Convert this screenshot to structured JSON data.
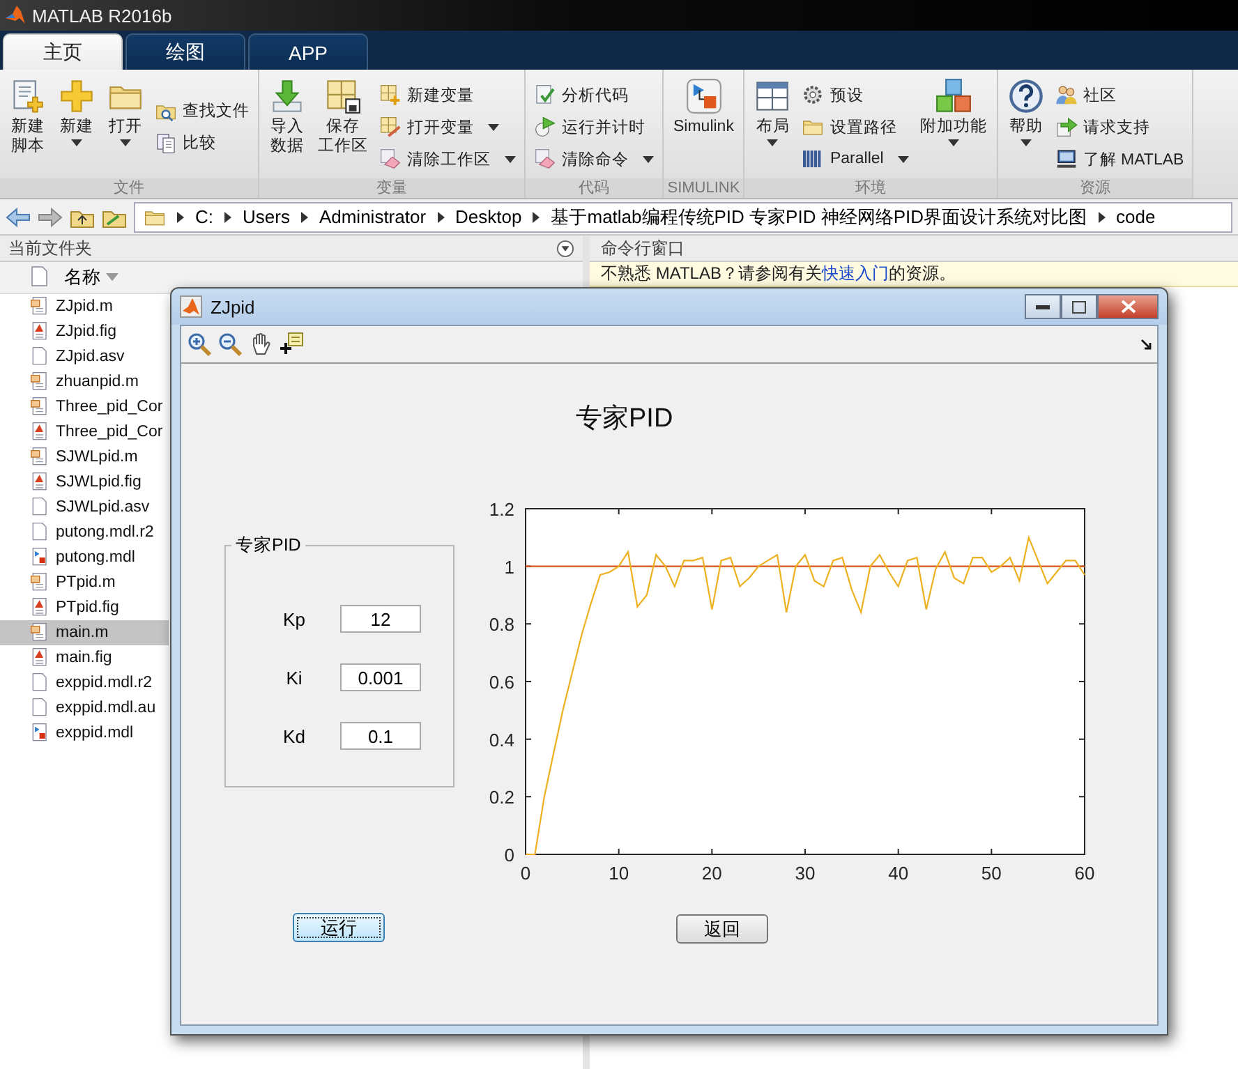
{
  "window": {
    "title": "MATLAB R2016b"
  },
  "tabs": [
    {
      "label": "主页",
      "selected": true
    },
    {
      "label": "绘图",
      "selected": false
    },
    {
      "label": "APP",
      "selected": false
    }
  ],
  "ribbon": {
    "groups": [
      {
        "label": "文件",
        "items": [
          {
            "kind": "large",
            "label": [
              "新建",
              "脚本"
            ],
            "dropdown": false
          },
          {
            "kind": "large",
            "label": "新建",
            "dropdown": true
          },
          {
            "kind": "large",
            "label": "打开",
            "dropdown": true
          },
          {
            "kind": "small",
            "label": "查找文件",
            "dropdown": false
          },
          {
            "kind": "small",
            "label": "比较",
            "dropdown": false
          }
        ]
      },
      {
        "label": "变量",
        "items": [
          {
            "kind": "large",
            "label": [
              "导入",
              "数据"
            ],
            "dropdown": false
          },
          {
            "kind": "large",
            "label": [
              "保存",
              "工作区"
            ],
            "dropdown": false
          },
          {
            "kind": "small",
            "label": "新建变量",
            "dropdown": false
          },
          {
            "kind": "small",
            "label": "打开变量",
            "dropdown": true
          },
          {
            "kind": "small",
            "label": "清除工作区",
            "dropdown": true
          }
        ]
      },
      {
        "label": "代码",
        "items": [
          {
            "kind": "small",
            "label": "分析代码",
            "dropdown": false
          },
          {
            "kind": "small",
            "label": "运行并计时",
            "dropdown": false
          },
          {
            "kind": "small",
            "label": "清除命令",
            "dropdown": true
          }
        ]
      },
      {
        "label": "SIMULINK",
        "items": [
          {
            "kind": "large",
            "label": "Simulink",
            "dropdown": false
          }
        ]
      },
      {
        "label": "环境",
        "items": [
          {
            "kind": "large",
            "label": "布局",
            "dropdown": true
          },
          {
            "kind": "small",
            "label": "预设",
            "dropdown": false
          },
          {
            "kind": "small",
            "label": "设置路径",
            "dropdown": false
          },
          {
            "kind": "small",
            "label": "Parallel",
            "dropdown": true
          },
          {
            "kind": "large",
            "label": "附加功能",
            "dropdown": true
          }
        ]
      },
      {
        "label": "资源",
        "items": [
          {
            "kind": "large",
            "label": "帮助",
            "dropdown": true
          },
          {
            "kind": "small",
            "label": "社区",
            "dropdown": false
          },
          {
            "kind": "small",
            "label": "请求支持",
            "dropdown": false
          },
          {
            "kind": "small",
            "label": "了解 MATLAB",
            "dropdown": false
          }
        ]
      }
    ]
  },
  "address_bar": {
    "segments": [
      "C:",
      "Users",
      "Administrator",
      "Desktop",
      "基于matlab编程传统PID 专家PID 神经网络PID界面设计系统对比图",
      "code"
    ]
  },
  "current_folder": {
    "title": "当前文件夹",
    "column": "名称",
    "files": [
      {
        "name": "ZJpid.m",
        "kind": "m",
        "selected": false
      },
      {
        "name": "ZJpid.fig",
        "kind": "fig",
        "selected": false
      },
      {
        "name": "ZJpid.asv",
        "kind": "file",
        "selected": false
      },
      {
        "name": "zhuanpid.m",
        "kind": "m",
        "selected": false
      },
      {
        "name": "Three_pid_Cor",
        "kind": "m",
        "selected": false
      },
      {
        "name": "Three_pid_Cor",
        "kind": "fig",
        "selected": false
      },
      {
        "name": "SJWLpid.m",
        "kind": "m",
        "selected": false
      },
      {
        "name": "SJWLpid.fig",
        "kind": "fig",
        "selected": false
      },
      {
        "name": "SJWLpid.asv",
        "kind": "file",
        "selected": false
      },
      {
        "name": "putong.mdl.r2",
        "kind": "file",
        "selected": false
      },
      {
        "name": "putong.mdl",
        "kind": "mdl",
        "selected": false
      },
      {
        "name": "PTpid.m",
        "kind": "m",
        "selected": false
      },
      {
        "name": "PTpid.fig",
        "kind": "fig",
        "selected": false
      },
      {
        "name": "main.m",
        "kind": "m",
        "selected": true
      },
      {
        "name": "main.fig",
        "kind": "fig",
        "selected": false
      },
      {
        "name": "exppid.mdl.r2",
        "kind": "file",
        "selected": false
      },
      {
        "name": "exppid.mdl.au",
        "kind": "file",
        "selected": false
      },
      {
        "name": "exppid.mdl",
        "kind": "mdl",
        "selected": false
      }
    ]
  },
  "command_window": {
    "title": "命令行窗口",
    "hint": {
      "before": "不熟悉 MATLAB？请参阅有关",
      "link": "快速入门",
      "after": "的资源。"
    }
  },
  "figure": {
    "title": "ZJpid",
    "heading": "专家PID",
    "panel": {
      "title": "专家PID",
      "params": [
        {
          "label": "Kp",
          "value": "12"
        },
        {
          "label": "Ki",
          "value": "0.001"
        },
        {
          "label": "Kd",
          "value": "0.1"
        }
      ]
    },
    "chart_data": {
      "type": "line",
      "x": [
        0,
        1,
        2,
        3,
        4,
        5,
        6,
        7,
        8,
        9,
        10,
        11,
        12,
        13,
        14,
        15,
        16,
        17,
        18,
        19,
        20,
        21,
        22,
        23,
        24,
        25,
        26,
        27,
        28,
        29,
        30,
        31,
        32,
        33,
        34,
        35,
        36,
        37,
        38,
        39,
        40,
        41,
        42,
        43,
        44,
        45,
        46,
        47,
        48,
        49,
        50,
        51,
        52,
        53,
        54,
        55,
        56,
        57,
        58,
        59,
        60
      ],
      "series": [
        {
          "color": "#d95319",
          "values": [
            1,
            1,
            1,
            1,
            1,
            1,
            1,
            1,
            1,
            1,
            1,
            1,
            1,
            1,
            1,
            1,
            1,
            1,
            1,
            1,
            1,
            1,
            1,
            1,
            1,
            1,
            1,
            1,
            1,
            1,
            1,
            1,
            1,
            1,
            1,
            1,
            1,
            1,
            1,
            1,
            1,
            1,
            1,
            1,
            1,
            1,
            1,
            1,
            1,
            1,
            1,
            1,
            1,
            1,
            1,
            1,
            1,
            1,
            1,
            1,
            1
          ]
        },
        {
          "color": "#edb120",
          "values": [
            0,
            0,
            0.2,
            0.35,
            0.5,
            0.63,
            0.76,
            0.87,
            0.97,
            0.98,
            1.0,
            1.05,
            0.86,
            0.9,
            1.04,
            1.0,
            0.93,
            1.02,
            1.02,
            1.03,
            0.85,
            1.02,
            1.03,
            0.93,
            0.96,
            1.0,
            1.02,
            1.04,
            0.84,
            1.0,
            1.04,
            0.95,
            0.93,
            1.02,
            1.03,
            0.92,
            0.84,
            1.0,
            1.04,
            0.98,
            0.93,
            1.02,
            1.03,
            0.85,
            0.99,
            1.05,
            0.96,
            0.94,
            1.03,
            1.03,
            0.98,
            1.0,
            1.03,
            0.95,
            1.1,
            1.02,
            0.94,
            0.98,
            1.02,
            1.02,
            0.97
          ]
        }
      ],
      "xlim": [
        0,
        60
      ],
      "ylim": [
        0,
        1.2
      ],
      "xticks": [
        0,
        10,
        20,
        30,
        40,
        50,
        60
      ],
      "yticks": [
        0,
        0.2,
        0.4,
        0.6,
        0.8,
        1,
        1.2
      ]
    },
    "buttons": [
      {
        "label": "运行",
        "focused": true
      },
      {
        "label": "返回",
        "focused": false
      }
    ]
  }
}
